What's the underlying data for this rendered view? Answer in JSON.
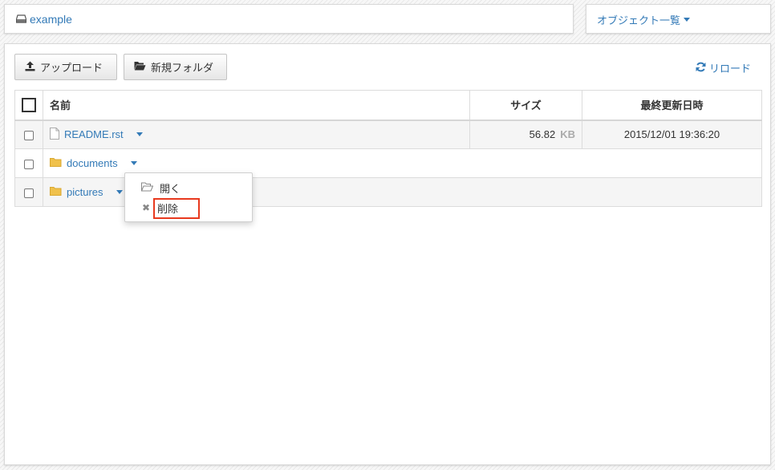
{
  "header": {
    "bucket_name": "example",
    "object_menu_label": "オブジェクト一覧"
  },
  "toolbar": {
    "upload_label": "アップロード",
    "new_folder_label": "新規フォルダ",
    "reload_label": "リロード"
  },
  "table": {
    "columns": [
      "名前",
      "サイズ",
      "最終更新日時"
    ],
    "rows": [
      {
        "name": "README.rst",
        "type": "file",
        "size": "56.82",
        "size_unit": "KB",
        "modified": "2015/12/01 19:36:20"
      },
      {
        "name": "documents",
        "type": "folder",
        "size": "",
        "size_unit": "",
        "modified": ""
      },
      {
        "name": "pictures",
        "type": "folder",
        "size": "",
        "size_unit": "",
        "modified": ""
      }
    ]
  },
  "context_menu": {
    "items": [
      {
        "label": "開く",
        "icon": "folder-open-outline-icon"
      },
      {
        "label": "削除",
        "icon": "close-icon"
      }
    ],
    "highlighted": "削除"
  },
  "colors": {
    "link": "#337ab7",
    "highlight": "#e8391e",
    "folder": "#f0c14b"
  }
}
